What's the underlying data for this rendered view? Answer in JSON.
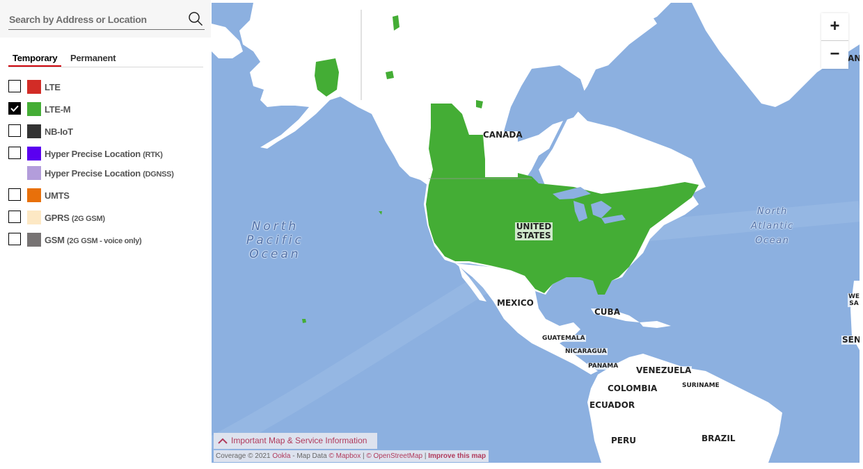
{
  "search": {
    "placeholder": "Search by Address or Location",
    "value": "",
    "icon": "search-icon"
  },
  "tabs": [
    {
      "label": "Temporary",
      "active": true
    },
    {
      "label": "Permanent",
      "active": false
    }
  ],
  "legend": [
    {
      "label": "LTE",
      "sub": "",
      "color": "#d22c26",
      "checked": false,
      "has_checkbox": true
    },
    {
      "label": "LTE-M",
      "sub": "",
      "color": "#44ad35",
      "checked": true,
      "has_checkbox": true
    },
    {
      "label": "NB-IoT",
      "sub": "",
      "color": "#333333",
      "checked": false,
      "has_checkbox": true
    },
    {
      "label": "Hyper Precise Location ",
      "sub": "(RTK)",
      "color": "#5a00f0",
      "checked": false,
      "has_checkbox": true
    },
    {
      "label": "Hyper Precise Location ",
      "sub": "(DGNSS)",
      "color": "#b39ddb",
      "checked": false,
      "has_checkbox": false
    },
    {
      "label": "UMTS",
      "sub": "",
      "color": "#e8700a",
      "checked": false,
      "has_checkbox": true
    },
    {
      "label": "GPRS ",
      "sub": "(2G GSM)",
      "color": "#fde8c4",
      "checked": false,
      "has_checkbox": true
    },
    {
      "label": "GSM ",
      "sub": "(2G GSM - voice only)",
      "color": "#777373",
      "checked": false,
      "has_checkbox": true
    }
  ],
  "map": {
    "zoom_in": "+",
    "zoom_out": "−",
    "colors": {
      "ocean": "#8cb0e0",
      "land": "#ffffff",
      "coverage": "#44ad35",
      "accent": "#cd040b",
      "link": "#b03a5b"
    },
    "country_labels": [
      "CANADA",
      "UNITED STATES",
      "MEXICO",
      "CUBA",
      "GUATEMALA",
      "NICARAGUA",
      "PANAMA",
      "VENEZUELA",
      "COLOMBIA",
      "SURINAME",
      "ECUADOR",
      "PERU",
      "BRAZIL",
      "AN",
      "WE SA",
      "SEN"
    ],
    "ocean_labels": {
      "pacific": "North\nPacific\nOcean",
      "atlantic": "North\nAtlantic\nOcean"
    },
    "info_bar": "Important Map & Service Information",
    "attribution": {
      "prefix": "Coverage © 2021 ",
      "ookla": "Ookla",
      "mid": " - Map Data ",
      "mapbox": "© Mapbox",
      "sep1": " | ",
      "osm": "© OpenStreetMap",
      "sep2": " | ",
      "improve": "Improve this map"
    }
  }
}
